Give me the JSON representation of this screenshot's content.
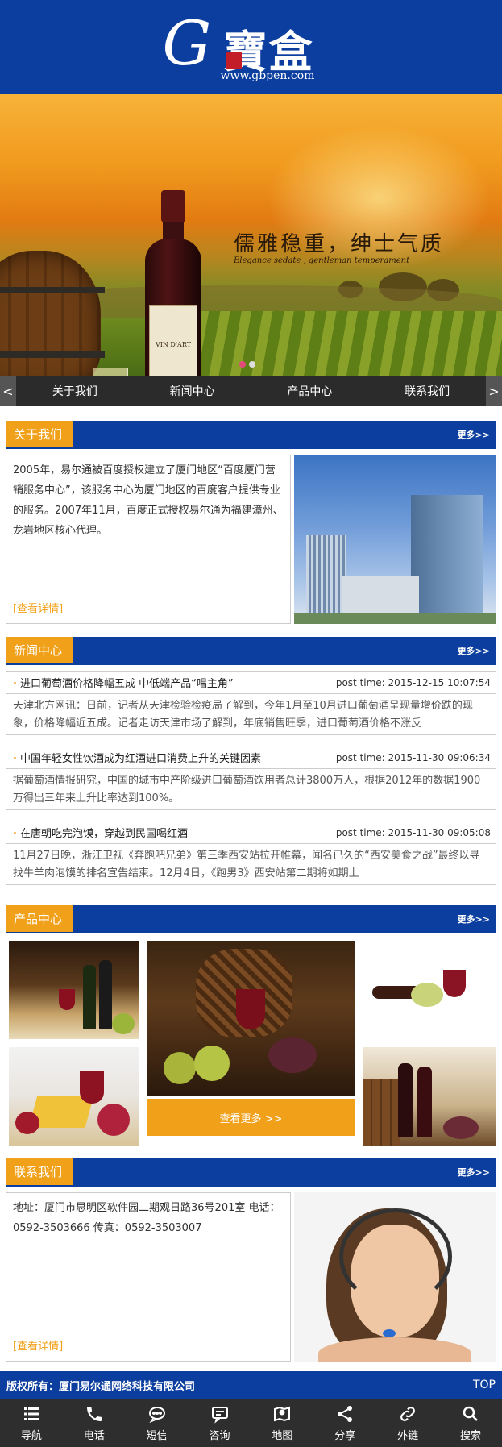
{
  "header": {
    "logo_letter": "G",
    "logo_cn": "寶盒",
    "logo_url": "www.gbpen.com"
  },
  "banner": {
    "slogan": "儒雅稳重，绅士气质",
    "slogan_en": "Elegance sedate , gentleman temperament",
    "bottle_label": "VIN D'ART"
  },
  "nav": {
    "prev": "<",
    "next": ">",
    "items": [
      "关于我们",
      "新闻中心",
      "产品中心",
      "联系我们"
    ]
  },
  "about": {
    "title": "关于我们",
    "more": "更多>>",
    "text": "2005年，易尔通被百度授权建立了厦门地区“百度厦门营销服务中心”，该服务中心为厦门地区的百度客户提供专业的服务。2007年11月，百度正式授权易尔通为福建漳州、龙岩地区核心代理。",
    "link": "[查看详情]"
  },
  "news": {
    "title": "新闻中心",
    "more": "更多>>",
    "items": [
      {
        "title": "进口葡萄酒价格降幅五成 中低端产品“唱主角”",
        "time": "post time: 2015-12-15 10:07:54",
        "summary": "天津北方网讯：日前，记者从天津检验检疫局了解到，今年1月至10月进口葡萄酒呈现量增价跌的现象，价格降幅近五成。记者走访天津市场了解到，年底销售旺季，进口葡萄酒价格不涨反"
      },
      {
        "title": "中国年轻女性饮酒成为红酒进口消费上升的关键因素",
        "time": "post time: 2015-11-30 09:06:34",
        "summary": "据葡萄酒情报研究，中国的城市中产阶级进口葡萄酒饮用者总计3800万人，根据2012年的数据1900万得出三年来上升比率达到100%。"
      },
      {
        "title": "在唐朝吃完泡馍，穿越到民国喝红酒",
        "time": "post time: 2015-11-30 09:05:08",
        "summary": "11月27日晚，浙江卫视《奔跑吧兄弟》第三季西安站拉开帷幕，闻名已久的“西安美食之战”最终以寻找牛羊肉泡馍的排名宣告结束。12月4日，《跑男3》西安站第二期将如期上"
      }
    ]
  },
  "products": {
    "title": "产品中心",
    "more": "更多>>",
    "view_more": "查看更多 >>"
  },
  "contact": {
    "title": "联系我们",
    "more": "更多>>",
    "text": "地址：厦门市思明区软件园二期观日路36号201室 电话：0592-3503666 传真：0592-3503007",
    "link": "[查看详情]"
  },
  "footer": {
    "copyright": "版权所有：厦门易尔通网络科技有限公司",
    "top": "TOP"
  },
  "tabbar": [
    {
      "label": "导航",
      "icon": "menu-icon"
    },
    {
      "label": "电话",
      "icon": "phone-icon"
    },
    {
      "label": "短信",
      "icon": "sms-icon"
    },
    {
      "label": "咨询",
      "icon": "chat-icon"
    },
    {
      "label": "地图",
      "icon": "map-icon"
    },
    {
      "label": "分享",
      "icon": "share-icon"
    },
    {
      "label": "外链",
      "icon": "link-icon"
    },
    {
      "label": "搜索",
      "icon": "search-icon"
    }
  ],
  "colors": {
    "brand_blue": "#0b3e9e",
    "accent_orange": "#f0a019",
    "tab_bg": "#2e2e2e"
  }
}
